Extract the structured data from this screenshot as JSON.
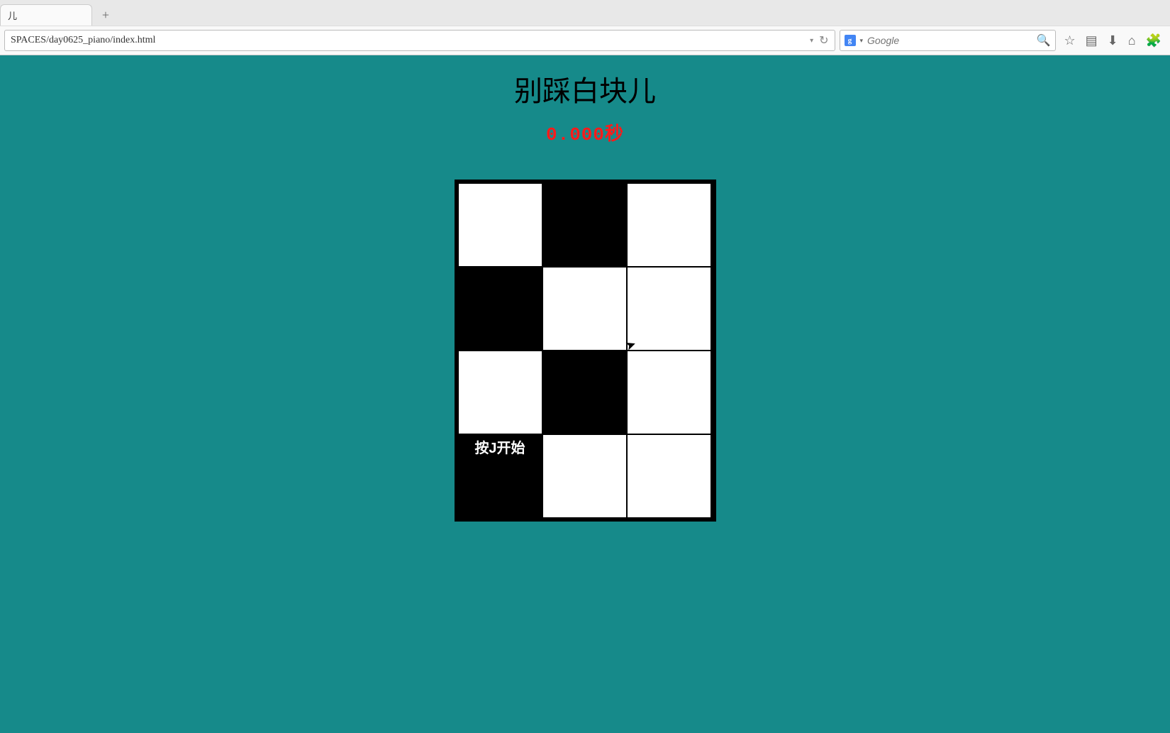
{
  "browser": {
    "tab_label": "儿",
    "new_tab_glyph": "+",
    "url": "SPACES/day0625_piano/index.html",
    "url_dropdown_glyph": "▾",
    "reload_glyph": "↻",
    "search_engine_glyph": "g",
    "search_engine_caret": "▾",
    "search_placeholder": "Google",
    "search_go_glyph": "🔍",
    "toolbar": {
      "bookmark_glyph": "☆",
      "reader_glyph": "▤",
      "downloads_glyph": "⬇",
      "home_glyph": "⌂",
      "addon_glyph": "🧩"
    }
  },
  "game": {
    "title": "别踩白块儿",
    "timer": "0.000秒",
    "start_prompt": "按J开始",
    "grid": [
      [
        "white",
        "black",
        "white"
      ],
      [
        "black",
        "white",
        "white"
      ],
      [
        "white",
        "black",
        "white"
      ],
      [
        "black",
        "white",
        "white"
      ]
    ],
    "prompt_cell": {
      "row": 3,
      "col": 0
    }
  }
}
